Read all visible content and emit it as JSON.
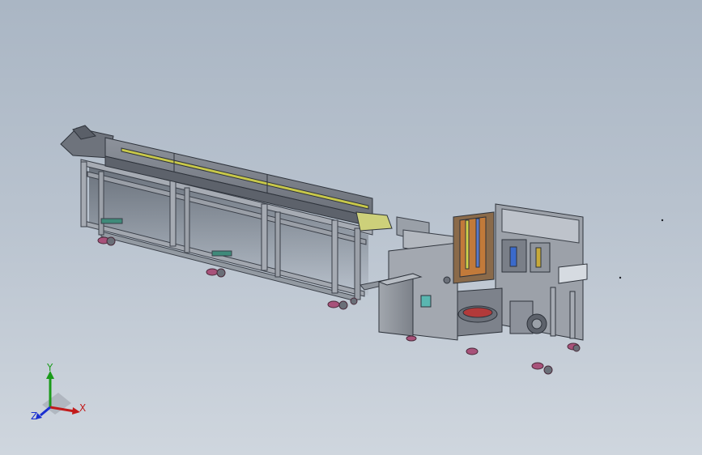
{
  "viewport": {
    "background_top": "#aab6c4",
    "background_bottom": "#cfd6de"
  },
  "triad": {
    "x_label": "X",
    "y_label": "Y",
    "z_label": "Z",
    "x_color": "#c21a1a",
    "y_color": "#1a9a1a",
    "z_color": "#1a2fd0"
  },
  "model": {
    "frame_color": "#9aa0aa",
    "frame_edge": "#3a3f48",
    "beam_color": "#7d828c",
    "rail_color": "#c8c84a",
    "cabinet_color": "#8f949c",
    "caster_color": "#a8527a"
  }
}
